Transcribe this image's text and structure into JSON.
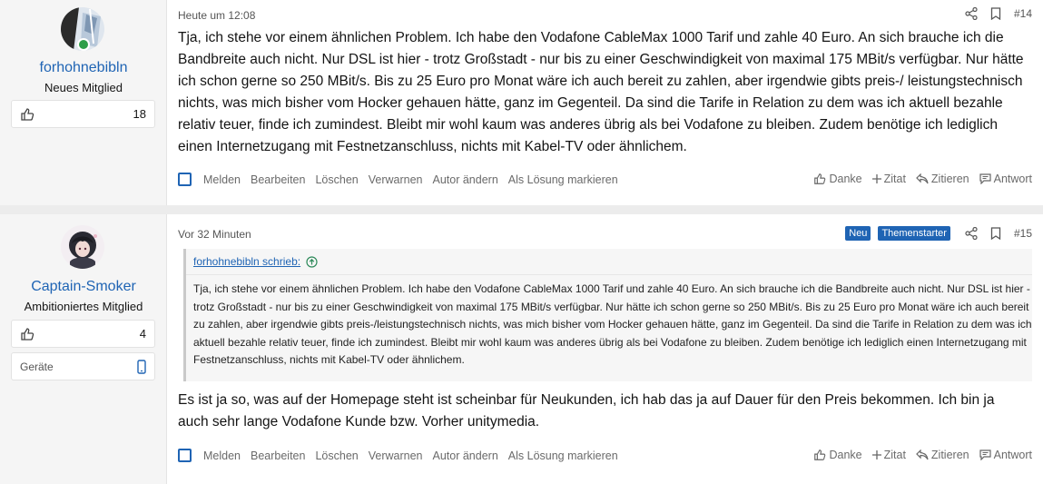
{
  "posts": [
    {
      "user": {
        "name": "forhohnebibln",
        "title": "Neues Mitglied",
        "likes": "18"
      },
      "time": "Heute um 12:08",
      "number": "#14",
      "body": "Tja, ich stehe vor einem ähnlichen Problem. Ich habe den Vodafone CableMax 1000 Tarif und zahle 40 Euro. An sich brauche ich die Bandbreite auch nicht. Nur DSL ist hier - trotz Großstadt - nur bis zu einer Geschwindigkeit von maximal 175 MBit/s verfügbar. Nur hätte ich schon gerne so 250 MBit/s. Bis zu 25 Euro pro Monat wäre ich auch bereit zu zahlen, aber irgendwie gibts preis-/ leistungstechnisch nichts, was mich bisher vom Hocker gehauen hätte, ganz im Gegenteil. Da sind die Tarife in Relation zu dem was ich aktuell bezahle relativ teuer, finde ich zumindest. Bleibt mir wohl kaum was anderes übrig als bei Vodafone zu bleiben. Zudem benötige ich lediglich einen Internetzugang mit Festnetzanschluss, nichts mit Kabel-TV oder ähnlichem."
    },
    {
      "user": {
        "name": "Captain-Smoker",
        "title": "Ambitioniertes Mitglied",
        "likes": "4",
        "devices_label": "Geräte"
      },
      "time": "Vor 32 Minuten",
      "number": "#15",
      "badges": {
        "new": "Neu",
        "starter": "Themenstarter"
      },
      "quote": {
        "author": "forhohnebibln schrieb:",
        "text": "Tja, ich stehe vor einem ähnlichen Problem. Ich habe den Vodafone CableMax 1000 Tarif und zahle 40 Euro. An sich brauche ich die Bandbreite auch nicht. Nur DSL ist hier - trotz Großstadt - nur bis zu einer Geschwindigkeit von maximal 175 MBit/s verfügbar. Nur hätte ich schon gerne so 250 MBit/s. Bis zu 25 Euro pro Monat wäre ich auch bereit zu zahlen, aber irgendwie gibts preis-/leistungstechnisch nichts, was mich bisher vom Hocker gehauen hätte, ganz im Gegenteil. Da sind die Tarife in Relation zu dem was ich aktuell bezahle relativ teuer, finde ich zumindest. Bleibt mir wohl kaum was anderes übrig als bei Vodafone zu bleiben. Zudem benötige ich lediglich einen Internetzugang mit Festnetzanschluss, nichts mit Kabel-TV oder ähnlichem."
      },
      "body": "Es ist ja so, was auf der Homepage steht ist scheinbar für Neukunden, ich hab das ja auf Dauer für den Preis bekommen. Ich bin ja auch sehr lange Vodafone Kunde bzw. Vorher unitymedia."
    }
  ],
  "actions": {
    "report": "Melden",
    "edit": "Bearbeiten",
    "delete": "Löschen",
    "warn": "Verwarnen",
    "change_author": "Autor ändern",
    "mark_solution": "Als Lösung markieren",
    "thanks": "Danke",
    "quote_plus": "Zitat",
    "cite": "Zitieren",
    "reply": "Antwort"
  },
  "colors": {
    "accent": "#1f64b4",
    "online": "#2e9e49",
    "sidebar": "#f5f5f5"
  }
}
